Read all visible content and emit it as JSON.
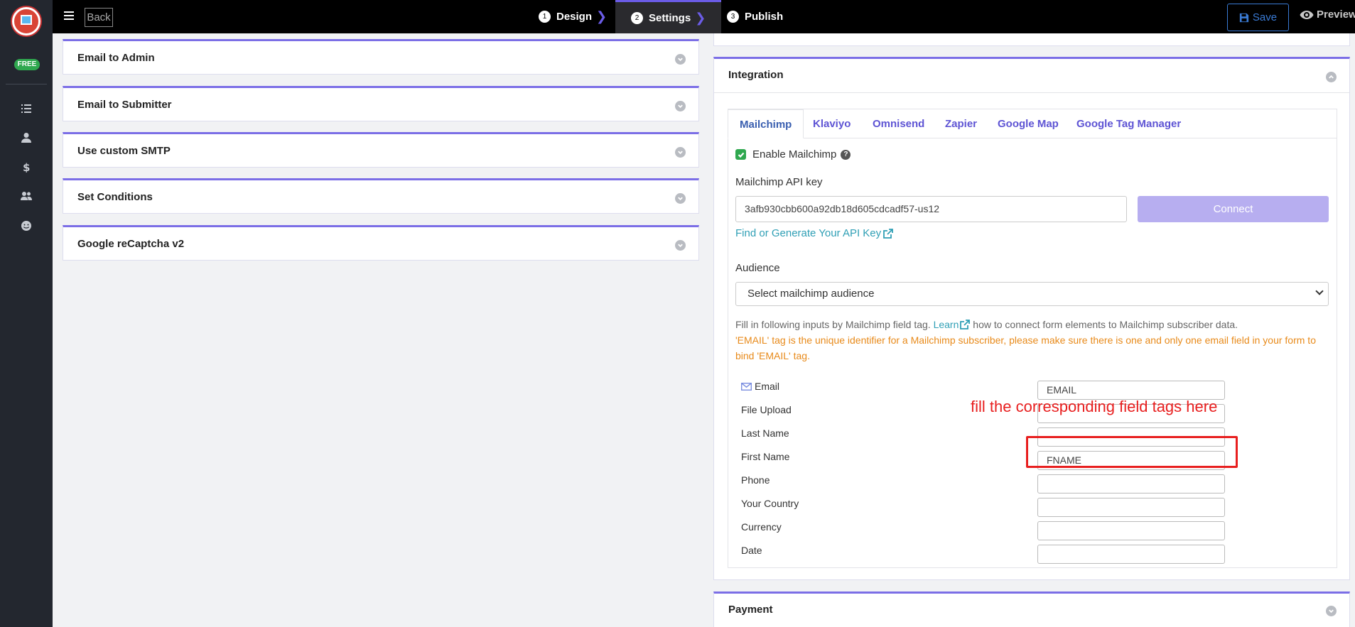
{
  "sidebar": {
    "badge": "FREE",
    "icons": [
      "list-icon",
      "user-icon",
      "dollar-icon",
      "users-icon",
      "smile-icon"
    ]
  },
  "topbar": {
    "back_label": "Back",
    "steps": [
      {
        "num": "1",
        "label": "Design"
      },
      {
        "num": "2",
        "label": "Settings"
      },
      {
        "num": "3",
        "label": "Publish"
      }
    ],
    "save_label": "Save",
    "preview_label": "Preview"
  },
  "left_panels": [
    "Email to Admin",
    "Email to Submitter",
    "Use custom SMTP",
    "Set Conditions",
    "Google reCaptcha v2"
  ],
  "integration": {
    "title": "Integration",
    "tabs": [
      "Mailchimp",
      "Klaviyo",
      "Omnisend",
      "Zapier",
      "Google Map",
      "Google Tag Manager"
    ],
    "enable_label": "Enable Mailchimp",
    "enable_checked": true,
    "help_glyph": "?",
    "api_key_label": "Mailchimp API key",
    "api_key_value": "3afb930cbb600a92db18d605cdcadf57-us12",
    "connect_label": "Connect",
    "api_link": "Find or Generate Your API Key",
    "audience_label": "Audience",
    "audience_select": "Select mailchimp audience",
    "info_before": "Fill in following inputs by Mailchimp field tag.",
    "info_link": "Learn",
    "info_after": "how to connect form elements to Mailchimp subscriber data.",
    "warning": "'EMAIL' tag is the unique identifier for a Mailchimp subscriber, please make sure there is one and only one email field in your form to bind 'EMAIL' tag.",
    "fields": [
      {
        "label": "Email",
        "value": "EMAIL"
      },
      {
        "label": "File Upload",
        "value": ""
      },
      {
        "label": "Last Name",
        "value": ""
      },
      {
        "label": "First Name",
        "value": "FNAME"
      },
      {
        "label": "Phone",
        "value": ""
      },
      {
        "label": "Your Country",
        "value": ""
      },
      {
        "label": "Currency",
        "value": ""
      },
      {
        "label": "Date",
        "value": ""
      }
    ]
  },
  "annotation": "fill the corresponding field tags here",
  "payment_title": "Payment",
  "colors": {
    "accent": "#7b6ee6",
    "annotation": "#e81f1f",
    "link": "#2f9fb5",
    "warning": "#e88a1a"
  }
}
